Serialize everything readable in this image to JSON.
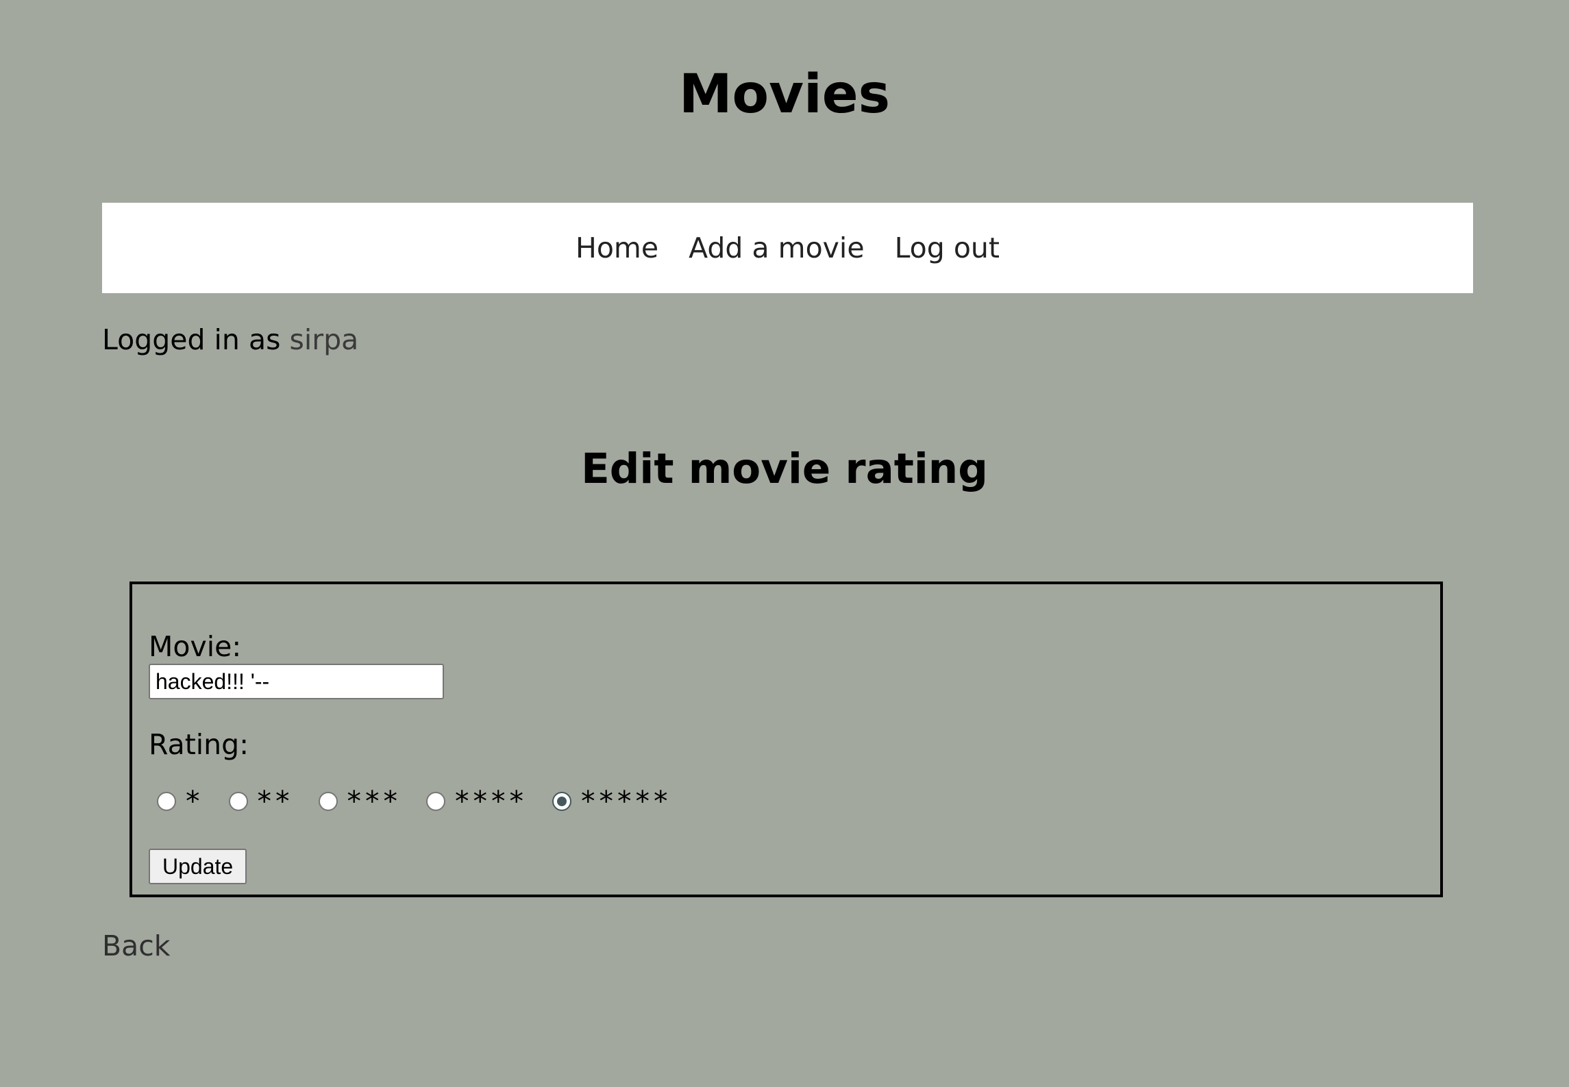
{
  "header": {
    "title": "Movies"
  },
  "nav": {
    "items": [
      {
        "label": "Home"
      },
      {
        "label": "Add a movie"
      },
      {
        "label": "Log out"
      }
    ]
  },
  "session": {
    "prefix": "Logged in as ",
    "username": "sirpa"
  },
  "page": {
    "heading": "Edit movie rating"
  },
  "form": {
    "movie_label": "Movie:",
    "movie_value": "hacked!!! '--",
    "rating_label": "Rating:",
    "rating_options": [
      {
        "label": "*",
        "checked": false
      },
      {
        "label": "**",
        "checked": false
      },
      {
        "label": "***",
        "checked": false
      },
      {
        "label": "****",
        "checked": false
      },
      {
        "label": "*****",
        "checked": true
      }
    ],
    "selected_rating": 5,
    "submit_label": "Update"
  },
  "footer": {
    "back_label": "Back"
  }
}
